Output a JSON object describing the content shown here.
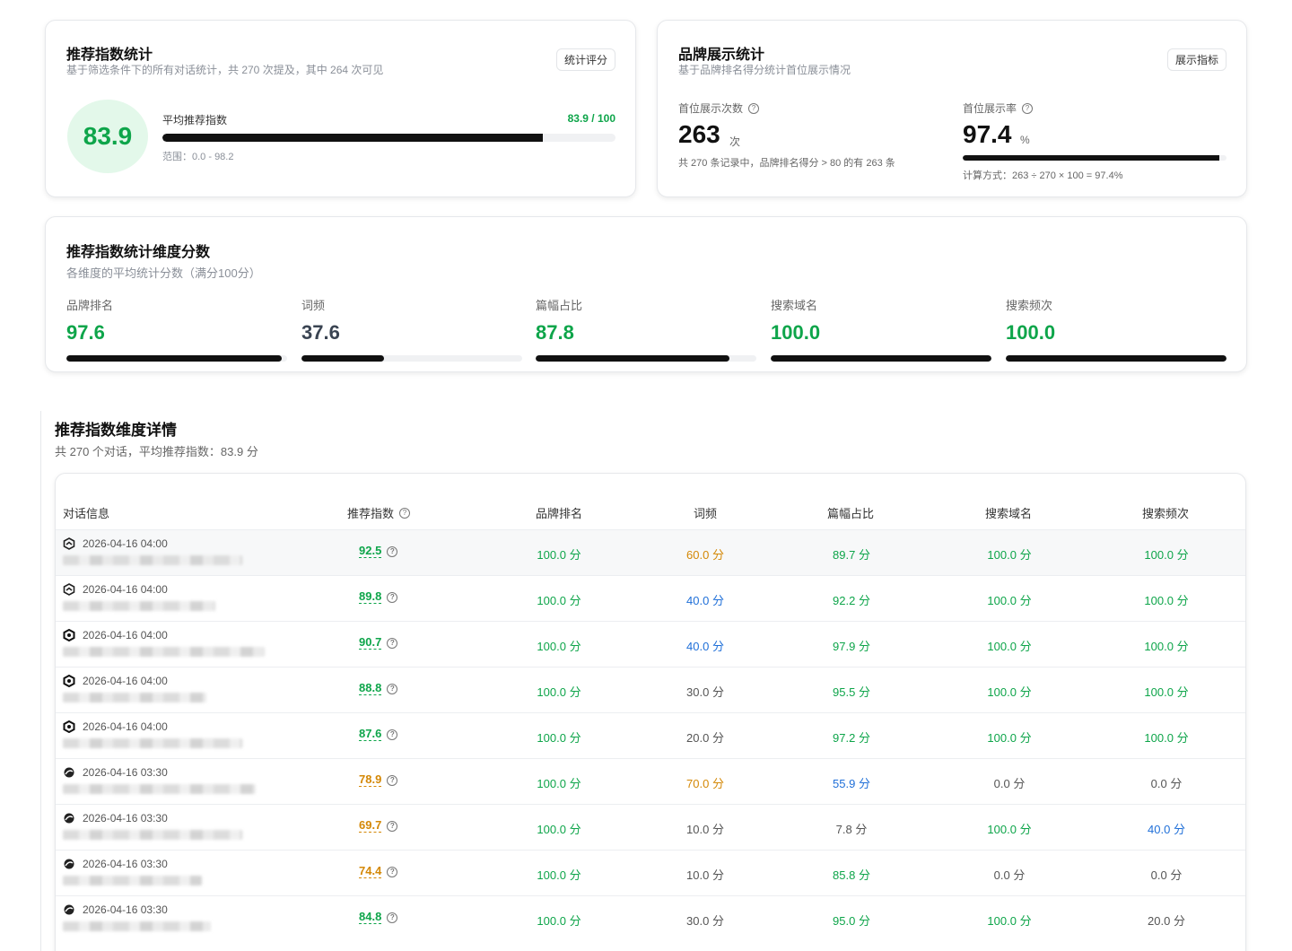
{
  "reco_card": {
    "title": "推荐指数统计",
    "subtitle": "基于筛选条件下的所有对话统计，共 270 次提及，其中 264 次可见",
    "pill": "统计评分",
    "score": "83.9",
    "bar_label": "平均推荐指数",
    "bar_value": "83.9 / 100",
    "bar_fraction": 0.839,
    "range": "范围：0.0 - 98.2"
  },
  "brand_card": {
    "title": "品牌展示统计",
    "subtitle": "基于品牌排名得分统计首位展示情况",
    "pill": "展示指标",
    "count_label": "首位展示次数",
    "count_value": "263",
    "count_unit": "次",
    "count_note": "共 270 条记录中，品牌排名得分 > 80 的有 263 条",
    "rate_label": "首位展示率",
    "rate_value": "97.4",
    "rate_unit": "%",
    "rate_fraction": 0.974,
    "rate_note": "计算方式：263 ÷ 270 × 100 = 97.4%"
  },
  "dims_card": {
    "title": "推荐指数统计维度分数",
    "subtitle": "各维度的平均统计分数（满分100分）",
    "dims": [
      {
        "label": "品牌排名",
        "value": "97.6",
        "fraction": 0.976,
        "color": "#0ea54a"
      },
      {
        "label": "词频",
        "value": "37.6",
        "fraction": 0.376,
        "color": "#3a4452"
      },
      {
        "label": "篇幅占比",
        "value": "87.8",
        "fraction": 0.878,
        "color": "#0ea54a"
      },
      {
        "label": "搜索域名",
        "value": "100.0",
        "fraction": 1.0,
        "color": "#0ea54a"
      },
      {
        "label": "搜索频次",
        "value": "100.0",
        "fraction": 1.0,
        "color": "#0ea54a"
      }
    ]
  },
  "detail": {
    "title": "推荐指数维度详情",
    "subtitle": "共 270 个对话，平均推荐指数：83.9 分",
    "headers": {
      "info": "对话信息",
      "score": "推荐指数",
      "brand_rank": "品牌排名",
      "word_freq": "词频",
      "length_ratio": "篇幅占比",
      "search_domain": "搜索域名",
      "search_freq": "搜索频次"
    },
    "colors": {
      "green": "#0ea54a",
      "orange": "#d48806",
      "blue": "#1f6fd8",
      "gray": "#555555"
    },
    "rows": [
      {
        "icon": "cube-icon",
        "time": "2026-04-16 04:00",
        "score": "92.5",
        "score_c": "green",
        "cells": [
          [
            "100.0 分",
            "green"
          ],
          [
            "60.0 分",
            "orange"
          ],
          [
            "89.7 分",
            "green"
          ],
          [
            "100.0 分",
            "green"
          ],
          [
            "100.0 分",
            "green"
          ]
        ]
      },
      {
        "icon": "cube-icon",
        "time": "2026-04-16 04:00",
        "score": "89.8",
        "score_c": "green",
        "cells": [
          [
            "100.0 分",
            "green"
          ],
          [
            "40.0 分",
            "blue"
          ],
          [
            "92.2 分",
            "green"
          ],
          [
            "100.0 分",
            "green"
          ],
          [
            "100.0 分",
            "green"
          ]
        ]
      },
      {
        "icon": "hex-icon",
        "time": "2026-04-16 04:00",
        "score": "90.7",
        "score_c": "green",
        "cells": [
          [
            "100.0 分",
            "green"
          ],
          [
            "40.0 分",
            "blue"
          ],
          [
            "97.9 分",
            "green"
          ],
          [
            "100.0 分",
            "green"
          ],
          [
            "100.0 分",
            "green"
          ]
        ]
      },
      {
        "icon": "hex-icon",
        "time": "2026-04-16 04:00",
        "score": "88.8",
        "score_c": "green",
        "cells": [
          [
            "100.0 分",
            "green"
          ],
          [
            "30.0 分",
            "gray"
          ],
          [
            "95.5 分",
            "green"
          ],
          [
            "100.0 分",
            "green"
          ],
          [
            "100.0 分",
            "green"
          ]
        ]
      },
      {
        "icon": "hex-icon",
        "time": "2026-04-16 04:00",
        "score": "87.6",
        "score_c": "green",
        "cells": [
          [
            "100.0 分",
            "green"
          ],
          [
            "20.0 分",
            "gray"
          ],
          [
            "97.2 分",
            "green"
          ],
          [
            "100.0 分",
            "green"
          ],
          [
            "100.0 分",
            "green"
          ]
        ]
      },
      {
        "icon": "swirl-icon",
        "time": "2026-04-16 03:30",
        "score": "78.9",
        "score_c": "orange",
        "cells": [
          [
            "100.0 分",
            "green"
          ],
          [
            "70.0 分",
            "orange"
          ],
          [
            "55.9 分",
            "blue"
          ],
          [
            "0.0 分",
            "gray"
          ],
          [
            "0.0 分",
            "gray"
          ]
        ]
      },
      {
        "icon": "swirl-icon",
        "time": "2026-04-16 03:30",
        "score": "69.7",
        "score_c": "orange",
        "cells": [
          [
            "100.0 分",
            "green"
          ],
          [
            "10.0 分",
            "gray"
          ],
          [
            "7.8 分",
            "gray"
          ],
          [
            "100.0 分",
            "green"
          ],
          [
            "40.0 分",
            "blue"
          ]
        ]
      },
      {
        "icon": "swirl-icon",
        "time": "2026-04-16 03:30",
        "score": "74.4",
        "score_c": "orange",
        "cells": [
          [
            "100.0 分",
            "green"
          ],
          [
            "10.0 分",
            "gray"
          ],
          [
            "85.8 分",
            "green"
          ],
          [
            "0.0 分",
            "gray"
          ],
          [
            "0.0 分",
            "gray"
          ]
        ]
      },
      {
        "icon": "swirl-icon",
        "time": "2026-04-16 03:30",
        "score": "84.8",
        "score_c": "green",
        "cells": [
          [
            "100.0 分",
            "green"
          ],
          [
            "30.0 分",
            "gray"
          ],
          [
            "95.0 分",
            "green"
          ],
          [
            "100.0 分",
            "green"
          ],
          [
            "20.0 分",
            "gray"
          ]
        ]
      }
    ]
  }
}
